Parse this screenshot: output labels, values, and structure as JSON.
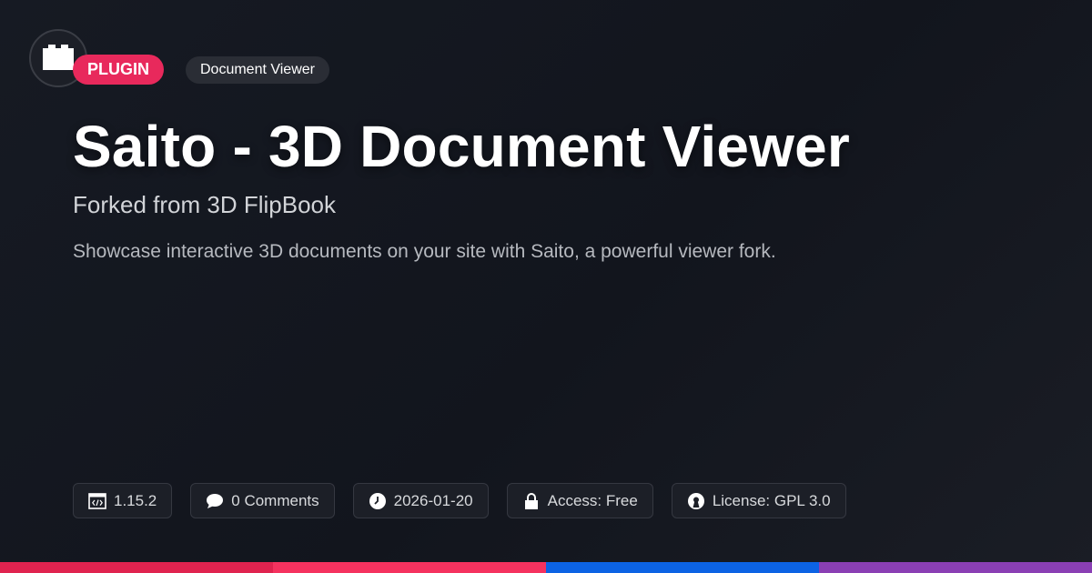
{
  "badges": {
    "type": "PLUGIN",
    "category": "Document Viewer"
  },
  "title": "Saito - 3D Document Viewer",
  "subtitle": "Forked from 3D FlipBook",
  "description": "Showcase interactive 3D documents on your site with Saito, a powerful viewer fork.",
  "meta": {
    "version": "1.15.2",
    "comments": "0 Comments",
    "date": "2026-01-20",
    "access": "Access: Free",
    "license": "License: GPL 3.0"
  },
  "icons": {
    "logo": "plugin-brick-icon",
    "version": "code-window-icon",
    "comments": "speech-bubble-icon",
    "date": "clock-icon",
    "access": "lock-icon",
    "license": "open-source-icon"
  },
  "colors": {
    "accent": "#e8295c",
    "bar": [
      "#e0234f",
      "#f5325f",
      "#0c63e4",
      "#8a3fb4"
    ]
  }
}
